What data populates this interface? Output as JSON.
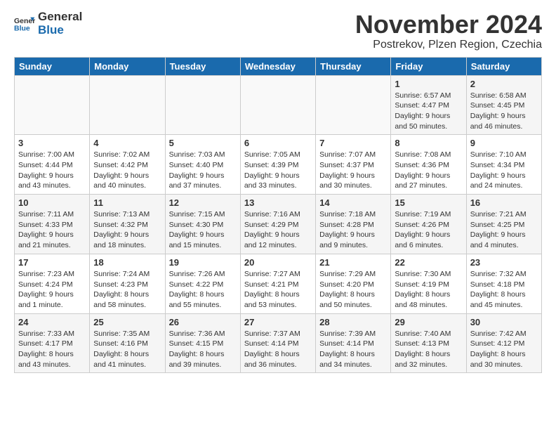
{
  "header": {
    "logo_general": "General",
    "logo_blue": "Blue",
    "month_title": "November 2024",
    "location": "Postrekov, Plzen Region, Czechia"
  },
  "calendar": {
    "days_of_week": [
      "Sunday",
      "Monday",
      "Tuesday",
      "Wednesday",
      "Thursday",
      "Friday",
      "Saturday"
    ],
    "weeks": [
      [
        {
          "day": "",
          "info": ""
        },
        {
          "day": "",
          "info": ""
        },
        {
          "day": "",
          "info": ""
        },
        {
          "day": "",
          "info": ""
        },
        {
          "day": "",
          "info": ""
        },
        {
          "day": "1",
          "info": "Sunrise: 6:57 AM\nSunset: 4:47 PM\nDaylight: 9 hours and 50 minutes."
        },
        {
          "day": "2",
          "info": "Sunrise: 6:58 AM\nSunset: 4:45 PM\nDaylight: 9 hours and 46 minutes."
        }
      ],
      [
        {
          "day": "3",
          "info": "Sunrise: 7:00 AM\nSunset: 4:44 PM\nDaylight: 9 hours and 43 minutes."
        },
        {
          "day": "4",
          "info": "Sunrise: 7:02 AM\nSunset: 4:42 PM\nDaylight: 9 hours and 40 minutes."
        },
        {
          "day": "5",
          "info": "Sunrise: 7:03 AM\nSunset: 4:40 PM\nDaylight: 9 hours and 37 minutes."
        },
        {
          "day": "6",
          "info": "Sunrise: 7:05 AM\nSunset: 4:39 PM\nDaylight: 9 hours and 33 minutes."
        },
        {
          "day": "7",
          "info": "Sunrise: 7:07 AM\nSunset: 4:37 PM\nDaylight: 9 hours and 30 minutes."
        },
        {
          "day": "8",
          "info": "Sunrise: 7:08 AM\nSunset: 4:36 PM\nDaylight: 9 hours and 27 minutes."
        },
        {
          "day": "9",
          "info": "Sunrise: 7:10 AM\nSunset: 4:34 PM\nDaylight: 9 hours and 24 minutes."
        }
      ],
      [
        {
          "day": "10",
          "info": "Sunrise: 7:11 AM\nSunset: 4:33 PM\nDaylight: 9 hours and 21 minutes."
        },
        {
          "day": "11",
          "info": "Sunrise: 7:13 AM\nSunset: 4:32 PM\nDaylight: 9 hours and 18 minutes."
        },
        {
          "day": "12",
          "info": "Sunrise: 7:15 AM\nSunset: 4:30 PM\nDaylight: 9 hours and 15 minutes."
        },
        {
          "day": "13",
          "info": "Sunrise: 7:16 AM\nSunset: 4:29 PM\nDaylight: 9 hours and 12 minutes."
        },
        {
          "day": "14",
          "info": "Sunrise: 7:18 AM\nSunset: 4:28 PM\nDaylight: 9 hours and 9 minutes."
        },
        {
          "day": "15",
          "info": "Sunrise: 7:19 AM\nSunset: 4:26 PM\nDaylight: 9 hours and 6 minutes."
        },
        {
          "day": "16",
          "info": "Sunrise: 7:21 AM\nSunset: 4:25 PM\nDaylight: 9 hours and 4 minutes."
        }
      ],
      [
        {
          "day": "17",
          "info": "Sunrise: 7:23 AM\nSunset: 4:24 PM\nDaylight: 9 hours and 1 minute."
        },
        {
          "day": "18",
          "info": "Sunrise: 7:24 AM\nSunset: 4:23 PM\nDaylight: 8 hours and 58 minutes."
        },
        {
          "day": "19",
          "info": "Sunrise: 7:26 AM\nSunset: 4:22 PM\nDaylight: 8 hours and 55 minutes."
        },
        {
          "day": "20",
          "info": "Sunrise: 7:27 AM\nSunset: 4:21 PM\nDaylight: 8 hours and 53 minutes."
        },
        {
          "day": "21",
          "info": "Sunrise: 7:29 AM\nSunset: 4:20 PM\nDaylight: 8 hours and 50 minutes."
        },
        {
          "day": "22",
          "info": "Sunrise: 7:30 AM\nSunset: 4:19 PM\nDaylight: 8 hours and 48 minutes."
        },
        {
          "day": "23",
          "info": "Sunrise: 7:32 AM\nSunset: 4:18 PM\nDaylight: 8 hours and 45 minutes."
        }
      ],
      [
        {
          "day": "24",
          "info": "Sunrise: 7:33 AM\nSunset: 4:17 PM\nDaylight: 8 hours and 43 minutes."
        },
        {
          "day": "25",
          "info": "Sunrise: 7:35 AM\nSunset: 4:16 PM\nDaylight: 8 hours and 41 minutes."
        },
        {
          "day": "26",
          "info": "Sunrise: 7:36 AM\nSunset: 4:15 PM\nDaylight: 8 hours and 39 minutes."
        },
        {
          "day": "27",
          "info": "Sunrise: 7:37 AM\nSunset: 4:14 PM\nDaylight: 8 hours and 36 minutes."
        },
        {
          "day": "28",
          "info": "Sunrise: 7:39 AM\nSunset: 4:14 PM\nDaylight: 8 hours and 34 minutes."
        },
        {
          "day": "29",
          "info": "Sunrise: 7:40 AM\nSunset: 4:13 PM\nDaylight: 8 hours and 32 minutes."
        },
        {
          "day": "30",
          "info": "Sunrise: 7:42 AM\nSunset: 4:12 PM\nDaylight: 8 hours and 30 minutes."
        }
      ]
    ]
  }
}
